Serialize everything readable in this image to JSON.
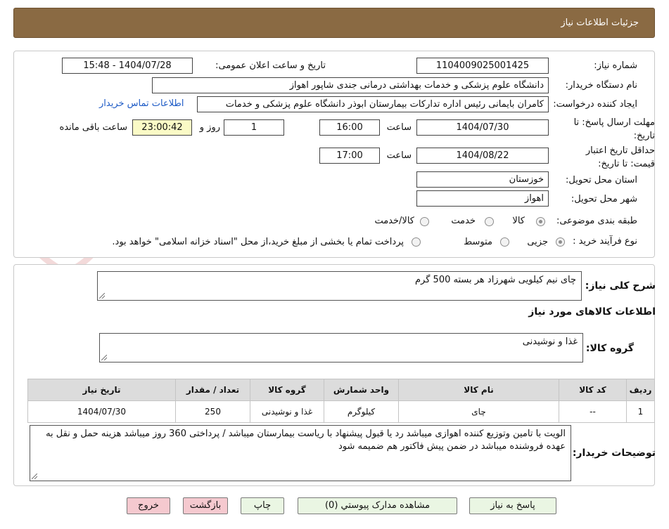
{
  "header": {
    "title": "جزئیات اطلاعات نیاز"
  },
  "form": {
    "need_number_label": "شماره نیاز:",
    "need_number": "1104009025001425",
    "announce_label": "تاریخ و ساعت اعلان عمومی:",
    "announce_value": "1404/07/28 - 15:48",
    "buyer_org_label": "نام دستگاه خریدار:",
    "buyer_org": "دانشگاه علوم پزشکی و خدمات بهداشتی درمانی جندی شاپور اهواز",
    "creator_label": "ایجاد کننده درخواست:",
    "creator": "کامران بایمانی رئیس اداره تدارکات بیمارستان ابوذر  دانشگاه علوم پزشکی و خدمات",
    "contact_link": "اطلاعات تماس خریدار",
    "deadline_label": "مهلت ارسال پاسخ: تا تاریخ:",
    "deadline_date": "1404/07/30",
    "time_label": "ساعت",
    "deadline_time": "16:00",
    "days_value": "1",
    "days_label": "روز و",
    "remaining_time": "23:00:42",
    "remaining_label": "ساعت باقی مانده",
    "validity_label": "حداقل تاریخ اعتبار قیمت: تا تاریخ:",
    "validity_date": "1404/08/22",
    "validity_time": "17:00",
    "province_label": "استان محل تحویل:",
    "province": "خوزستان",
    "city_label": "شهر محل تحویل:",
    "city": "اهواز",
    "category_label": "طبقه بندی موضوعی:",
    "category_options": [
      "کالا",
      "خدمت",
      "کالا/خدمت"
    ],
    "category_selected": "کالا",
    "process_label": "نوع فرآیند خرید :",
    "process_options": [
      "جزیی",
      "متوسط"
    ],
    "process_selected": "جزیی",
    "payment_note": "پرداخت تمام یا بخشی از مبلغ خرید،از محل \"اسناد خزانه اسلامی\" خواهد بود."
  },
  "details": {
    "summary_label": "شرح کلی نیاز:",
    "summary": "چای  نیم کیلویی شهرزاد هر بسته 500 گرم",
    "goods_info_title": "اطلاعات کالاهای مورد نیاز",
    "goods_group_label": "گروه کالا:",
    "goods_group": "غذا و نوشیدنی",
    "table": {
      "headers": [
        "ردیف",
        "کد کالا",
        "نام کالا",
        "واحد شمارش",
        "گروه کالا",
        "تعداد / مقدار",
        "تاریخ نیاز"
      ],
      "rows": [
        [
          "1",
          "--",
          "چای",
          "کیلوگرم",
          "غذا و نوشیدنی",
          "250",
          "1404/07/30"
        ]
      ]
    },
    "buyer_notes_label": "توضیحات خریدار:",
    "buyer_notes": "الویت با تامین وتوزیع کننده اهوازی  میباشد رد یا قبول پیشنهاد با ریاست بیمارستان میباشد / پرداختی 360 روز میباشد هزینه حمل و نقل به عهده فروشنده میباشد  در ضمن پیش فاکتور هم ضمیمه شود"
  },
  "buttons": {
    "reply": "پاسخ به نیاز",
    "attachments": "مشاهده مدارک پیوستي (0)",
    "print": "چاپ",
    "back": "بازگشت",
    "exit": "خروج"
  },
  "watermark": {
    "text": "AriaTender.neT"
  }
}
